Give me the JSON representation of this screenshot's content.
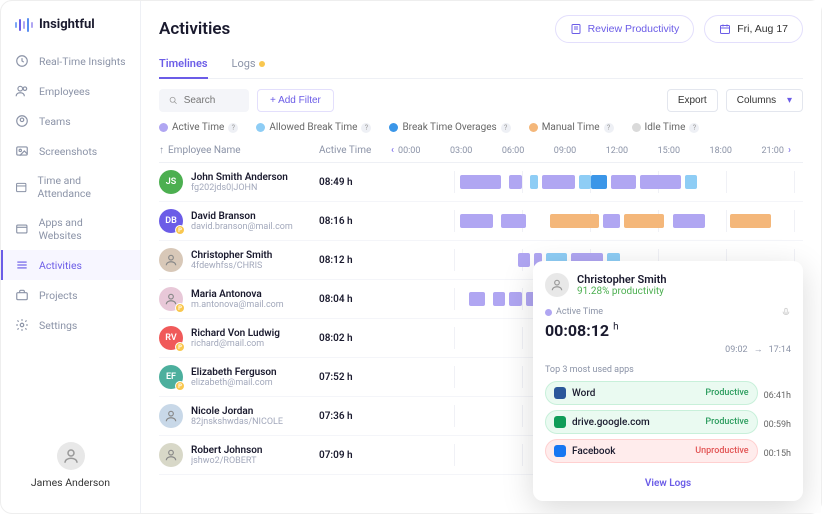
{
  "brand": "Insightful",
  "nav": [
    {
      "label": "Real-Time Insights",
      "icon": "clock"
    },
    {
      "label": "Employees",
      "icon": "users"
    },
    {
      "label": "Teams",
      "icon": "team"
    },
    {
      "label": "Screenshots",
      "icon": "image"
    },
    {
      "label": "Time and Attendance",
      "icon": "calendar"
    },
    {
      "label": "Apps and Websites",
      "icon": "window"
    },
    {
      "label": "Activities",
      "icon": "list",
      "active": true
    },
    {
      "label": "Projects",
      "icon": "briefcase"
    },
    {
      "label": "Settings",
      "icon": "gear"
    }
  ],
  "current_user": "James Anderson",
  "page_title": "Activities",
  "header": {
    "review": "Review Productivity",
    "date": "Fri, Aug 17"
  },
  "tabs": [
    {
      "label": "Timelines",
      "active": true
    },
    {
      "label": "Logs",
      "badge": true
    }
  ],
  "search_placeholder": "Search",
  "add_filter": "+  Add Filter",
  "export": "Export",
  "columns": "Columns",
  "legend": [
    {
      "label": "Active Time",
      "color": "#b0a6f2"
    },
    {
      "label": "Allowed Break Time",
      "color": "#8ecdf5"
    },
    {
      "label": "Break Time Overages",
      "color": "#3b96e8"
    },
    {
      "label": "Manual Time",
      "color": "#f4b77a"
    },
    {
      "label": "Idle Time",
      "color": "#dadada"
    }
  ],
  "cols": {
    "name": "Employee Name",
    "active": "Active Time"
  },
  "hours": [
    "00:00",
    "03:00",
    "06:00",
    "09:00",
    "12:00",
    "15:00",
    "18:00",
    "21:00"
  ],
  "employees": [
    {
      "name": "John Smith Anderson",
      "sub": "fg202jds0|JOHN",
      "time": "08:49 h",
      "avatar": {
        "type": "initials",
        "text": "JS",
        "bg": "#4caf50"
      },
      "segs": [
        {
          "l": 18,
          "w": 10,
          "c": "#b0a6f2"
        },
        {
          "l": 30,
          "w": 3,
          "c": "#b0a6f2"
        },
        {
          "l": 35,
          "w": 2,
          "c": "#8ecdf5"
        },
        {
          "l": 38,
          "w": 8,
          "c": "#b0a6f2"
        },
        {
          "l": 47,
          "w": 3,
          "c": "#8ecdf5"
        },
        {
          "l": 50,
          "w": 4,
          "c": "#3b96e8"
        },
        {
          "l": 55,
          "w": 6,
          "c": "#b0a6f2"
        },
        {
          "l": 62,
          "w": 10,
          "c": "#b0a6f2"
        },
        {
          "l": 73,
          "w": 3,
          "c": "#8ecdf5"
        }
      ]
    },
    {
      "name": "David Branson",
      "sub": "david.branson@mail.com",
      "time": "08:16 h",
      "avatar": {
        "type": "initials",
        "text": "DB",
        "bg": "#6b5ce7",
        "badge": true
      },
      "segs": [
        {
          "l": 18,
          "w": 8,
          "c": "#b0a6f2"
        },
        {
          "l": 28,
          "w": 6,
          "c": "#b0a6f2"
        },
        {
          "l": 40,
          "w": 12,
          "c": "#f4b77a"
        },
        {
          "l": 53,
          "w": 4,
          "c": "#b0a6f2"
        },
        {
          "l": 58,
          "w": 10,
          "c": "#f4b77a"
        },
        {
          "l": 70,
          "w": 8,
          "c": "#b0a6f2"
        },
        {
          "l": 84,
          "w": 10,
          "c": "#f4b77a"
        }
      ]
    },
    {
      "name": "Christopher Smith",
      "sub": "4fdewhfss/CHRIS",
      "time": "08:12 h",
      "avatar": {
        "type": "photo",
        "bg": "#d8c8b8"
      },
      "segs": [
        {
          "l": 32,
          "w": 3,
          "c": "#b0a6f2"
        },
        {
          "l": 36,
          "w": 2,
          "c": "#b0a6f2"
        },
        {
          "l": 39,
          "w": 5,
          "c": "#8ecdf5"
        },
        {
          "l": 45,
          "w": 8,
          "c": "#b0a6f2"
        },
        {
          "l": 54,
          "w": 3,
          "c": "#8ecdf5"
        }
      ]
    },
    {
      "name": "Maria Antonova",
      "sub": "m.antonova@mail.com",
      "time": "08:04 h",
      "avatar": {
        "type": "photo",
        "bg": "#e8c8d8",
        "badge": true
      },
      "segs": [
        {
          "l": 20,
          "w": 4,
          "c": "#b0a6f2"
        },
        {
          "l": 26,
          "w": 3,
          "c": "#b0a6f2"
        },
        {
          "l": 30,
          "w": 3,
          "c": "#b0a6f2"
        },
        {
          "l": 34,
          "w": 8,
          "c": "#b0a6f2"
        }
      ]
    },
    {
      "name": "Richard Von Ludwig",
      "sub": "richard@mail.com",
      "time": "08:02 h",
      "avatar": {
        "type": "initials",
        "text": "RV",
        "bg": "#f05a5a",
        "badge": true
      },
      "segs": []
    },
    {
      "name": "Elizabeth Ferguson",
      "sub": "elizabeth@mail.com",
      "time": "07:52 h",
      "avatar": {
        "type": "initials",
        "text": "EF",
        "bg": "#4caf9d",
        "badge": true
      },
      "segs": [
        {
          "l": 38,
          "w": 5,
          "c": "#b0a6f2"
        }
      ]
    },
    {
      "name": "Nicole Jordan",
      "sub": "82jnskshwdas/NICOLE",
      "time": "07:36 h",
      "avatar": {
        "type": "photo",
        "bg": "#c8d8e8"
      },
      "segs": []
    },
    {
      "name": "Robert Johnson",
      "sub": "jshwo2/ROBERT",
      "time": "07:09 h",
      "avatar": {
        "type": "photo",
        "bg": "#d8d8c8"
      },
      "segs": []
    }
  ],
  "popover": {
    "name": "Christopher Smith",
    "productivity": "91.28% productivity",
    "active_label": "Active Time",
    "active_time": "00:08:12",
    "active_unit": "h",
    "range_from": "09:02",
    "range_to": "17:14",
    "apps_title": "Top 3 most used apps",
    "apps": [
      {
        "name": "Word",
        "tag": "Productive",
        "time": "06:41h",
        "type": "productive",
        "icon": "#2b579a"
      },
      {
        "name": "drive.google.com",
        "tag": "Productive",
        "time": "00:59h",
        "type": "productive",
        "icon": "#0f9d58"
      },
      {
        "name": "Facebook",
        "tag": "Unproductive",
        "time": "00:15h",
        "type": "unproductive",
        "icon": "#1877f2"
      }
    ],
    "view_logs": "View Logs"
  }
}
